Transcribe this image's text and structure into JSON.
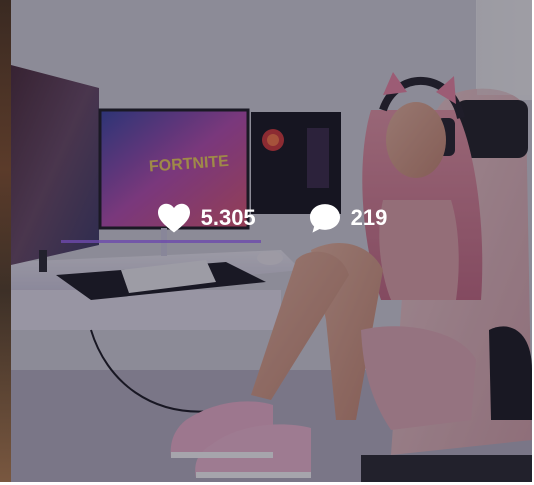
{
  "post": {
    "likes": "5.305",
    "comments": "219"
  },
  "icons": {
    "like": "heart-icon",
    "comment": "speech-bubble-icon"
  },
  "colors": {
    "overlay": "#141224",
    "stat_text": "#ffffff"
  }
}
